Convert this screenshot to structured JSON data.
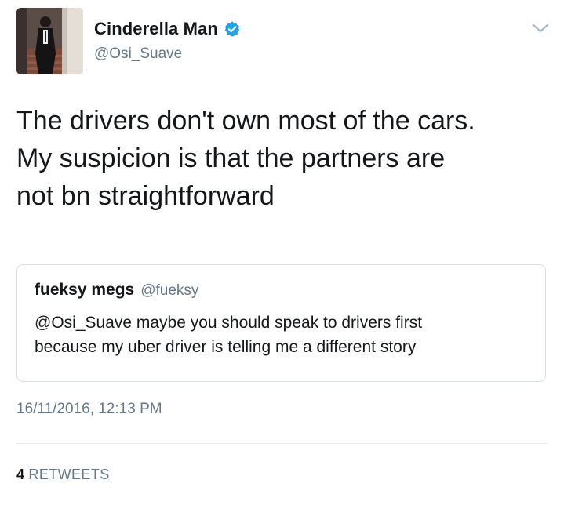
{
  "tweet": {
    "author": {
      "display_name": "Cinderella Man",
      "handle": "@Osi_Suave",
      "verified": true
    },
    "text_lines": [
      "The drivers don't own most of the cars.",
      "My suspicion is that the partners are",
      "not bn straightforward"
    ],
    "quoted_tweet": {
      "display_name": "fueksy megs",
      "handle": "@fueksy",
      "text_lines": [
        "@Osi_Suave maybe you should speak to drivers first",
        "because my uber driver is telling me a different story"
      ]
    },
    "timestamp": "16/11/2016, 12:13 PM",
    "stats": {
      "retweet_count": "4",
      "retweet_label": "RETWEETS"
    }
  },
  "colors": {
    "text_primary": "#14171a",
    "text_secondary": "#657786",
    "verified_badge": "#1da1f2",
    "border": "#d6dde3"
  },
  "icons": {
    "verified": "verified-badge-icon",
    "caret": "chevron-down-icon"
  }
}
